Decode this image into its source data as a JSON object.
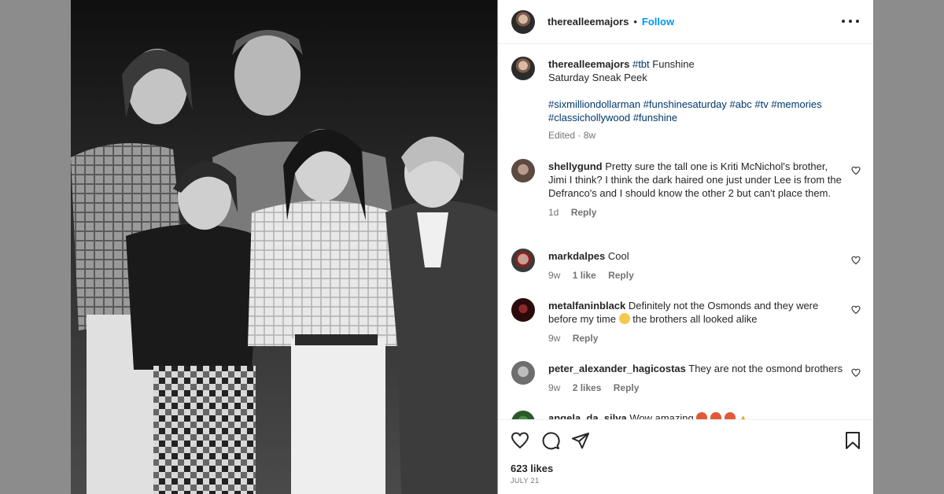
{
  "post": {
    "username": "therealleemajors",
    "follow_label": "Follow",
    "caption": {
      "username": "therealleemajors",
      "text_start": "#tbt",
      "text_mid": " Funshine",
      "text_line2": "Saturday Sneak Peek",
      "hashtags_line1": [
        "#sixmilliondollarman",
        "#funshinesaturday",
        "#abc",
        "#tv",
        "#memories"
      ],
      "hashtags_line2": [
        "#classichollywood",
        "#funshine"
      ],
      "edited": "Edited · 8w"
    },
    "comments": [
      {
        "username": "shellygund",
        "text": "Pretty sure the tall one is Kriti McNichol's brother, Jimi I think? I think the dark haired one just under Lee is from the Defranco's and I should know the other 2 but can't place them.",
        "time": "1d",
        "likes": "",
        "reply": "Reply"
      },
      {
        "username": "markdalpes",
        "text": "Cool",
        "time": "9w",
        "likes": "1 like",
        "reply": "Reply"
      },
      {
        "username": "metalfaninblack",
        "text_before": "Definitely not the Osmonds and they were before my time",
        "text_after": "the brothers all looked alike",
        "time": "9w",
        "likes": "",
        "reply": "Reply"
      },
      {
        "username": "peter_alexander_hagicostas",
        "text": "They are not the osmond brothers",
        "time": "9w",
        "likes": "2 likes",
        "reply": "Reply"
      },
      {
        "username": "angela_da_silva",
        "text": "Wow amazing"
      }
    ],
    "likes_count": "623 likes",
    "date": "JULY 21"
  },
  "icons": {
    "more": "more-options-icon",
    "like": "heart-icon",
    "comment": "comment-bubble-icon",
    "share": "paper-plane-icon",
    "save": "bookmark-icon"
  }
}
